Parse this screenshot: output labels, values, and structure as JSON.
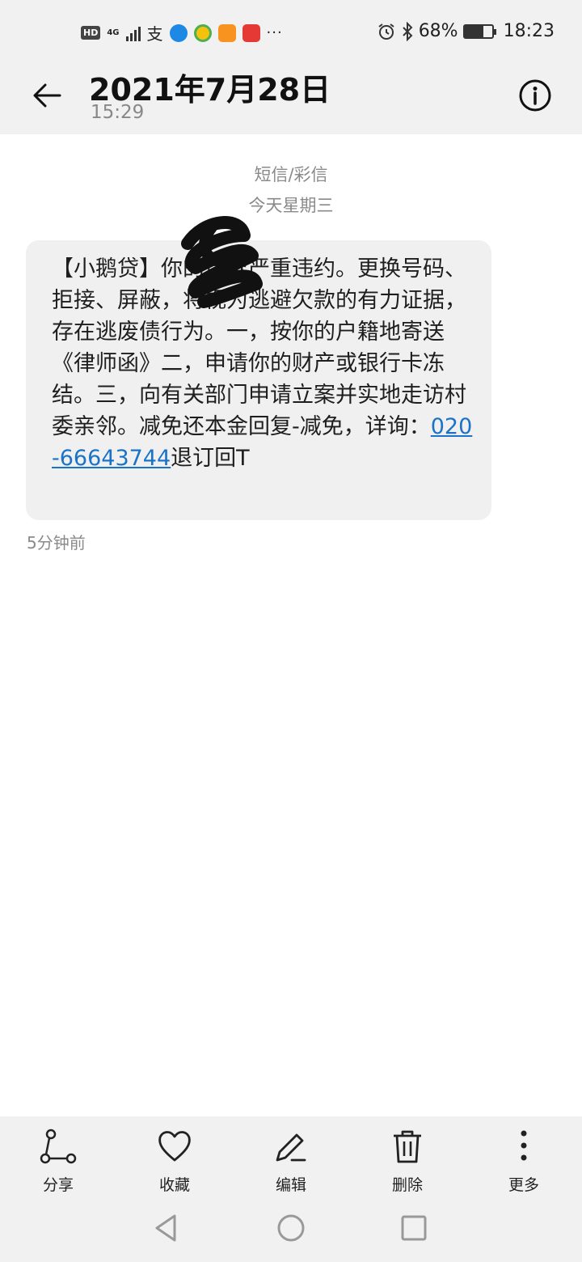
{
  "status_bar": {
    "hd": "HD",
    "net": "4G",
    "alipay_glyph": "支",
    "more": "···",
    "battery_text": "68%",
    "battery_level": 0.68,
    "time": "18:23"
  },
  "header": {
    "title": "2021年7月28日",
    "subtitle": "15:29"
  },
  "conversation": {
    "channel": "短信/彩信",
    "day": "今天星期三",
    "message": {
      "body": "【小鹅贷】",
      "body_rest": "你的借款严重违约。更换号码、拒接、屏蔽，将视为逃避欠款的有力证据，存在逃废债行为。一，按你的户籍地寄送《律师函》二，申请你的财产或银行卡冻结。三，向有关部门申请立案并实地走访村委亲邻。减免还本金回复-减免，详询：",
      "phone": "020-66643744",
      "tail": "退订回T",
      "time_ago": "5分钟前"
    }
  },
  "toolbar": {
    "share": "分享",
    "favorite": "收藏",
    "edit": "编辑",
    "delete": "删除",
    "more": "更多"
  },
  "colors": {
    "link": "#1a73c7",
    "bubble": "#f0f0f0",
    "chrome": "#f1f1f1"
  }
}
